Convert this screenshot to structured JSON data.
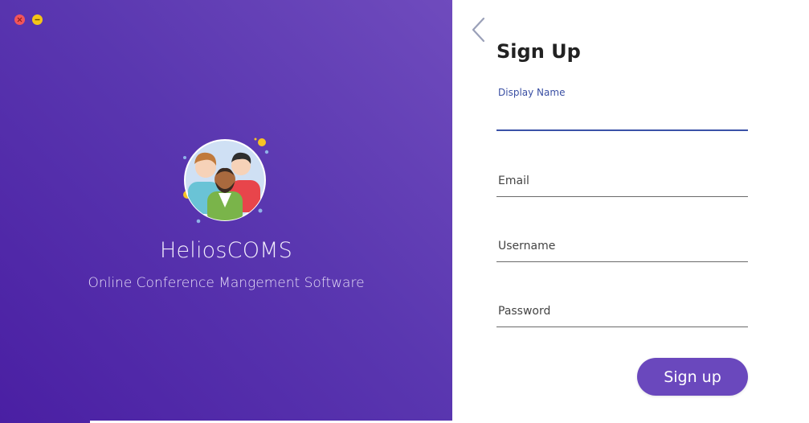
{
  "app": {
    "name": "HeliosCOMS",
    "subtitle": "Online Conference Mangement Software"
  },
  "window_controls": {
    "close_icon": "close-icon",
    "minimize_icon": "minimize-icon",
    "close_color": "#f2555a",
    "minimize_color": "#f5c518"
  },
  "form": {
    "title": "Sign Up",
    "fields": [
      {
        "label": "Display Name",
        "value": "",
        "active": true
      },
      {
        "label": "Email",
        "value": ""
      },
      {
        "label": "Username",
        "value": ""
      },
      {
        "label": "Password",
        "value": ""
      }
    ],
    "submit_label": "Sign up",
    "back_icon": "chevron-left-icon"
  },
  "colors": {
    "panel_gradient_start": "#6f4bbd",
    "panel_gradient_end": "#4a1fa3",
    "accent": "#6a48bd",
    "active_field": "#3b52a8"
  }
}
